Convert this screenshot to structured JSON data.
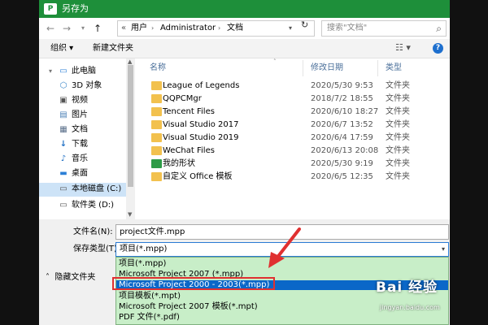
{
  "window": {
    "app_icon_text": "P",
    "title": "另存为",
    "accent_color": "#1e8f3a"
  },
  "nav": {
    "back_icon": "arrow-left-icon",
    "forward_icon": "arrow-right-icon",
    "recent_icon": "chevron-down-icon",
    "up_icon": "arrow-up-icon",
    "breadcrumb": [
      "用户",
      "Administrator",
      "文档"
    ],
    "overflow": "«",
    "search_placeholder": "搜索\"文档\""
  },
  "toolbar": {
    "organize_label": "组织 ▾",
    "new_folder_label": "新建文件夹"
  },
  "sidebar": {
    "items": [
      {
        "label": "此电脑",
        "icon": "computer-icon",
        "glyph": "💻",
        "selected": false,
        "expandable": true
      },
      {
        "label": "3D 对象",
        "icon": "cube-icon",
        "glyph": "⬡",
        "selected": false,
        "expandable": false
      },
      {
        "label": "视频",
        "icon": "video-icon",
        "glyph": "▣",
        "selected": false,
        "expandable": false
      },
      {
        "label": "图片",
        "icon": "picture-icon",
        "glyph": "▤",
        "selected": false,
        "expandable": false
      },
      {
        "label": "文档",
        "icon": "document-icon",
        "glyph": "▦",
        "selected": false,
        "expandable": false
      },
      {
        "label": "下载",
        "icon": "download-icon",
        "glyph": "↓",
        "selected": false,
        "expandable": false
      },
      {
        "label": "音乐",
        "icon": "music-icon",
        "glyph": "♪",
        "selected": false,
        "expandable": false
      },
      {
        "label": "桌面",
        "icon": "desktop-icon",
        "glyph": "▬",
        "selected": false,
        "expandable": false
      },
      {
        "label": "本地磁盘 (C:)",
        "icon": "drive-icon",
        "glyph": "▭",
        "selected": true,
        "expandable": false
      },
      {
        "label": "软件类 (D:)",
        "icon": "drive-icon",
        "glyph": "▭",
        "selected": false,
        "expandable": false
      }
    ]
  },
  "files": {
    "columns": {
      "name": "名称",
      "date": "修改日期",
      "type": "类型"
    },
    "rows": [
      {
        "name": "League of Legends",
        "date": "2020/5/30 9:53",
        "type": "文件夹",
        "icon": "folder-icon"
      },
      {
        "name": "QQPCMgr",
        "date": "2018/7/2 18:55",
        "type": "文件夹",
        "icon": "folder-icon"
      },
      {
        "name": "Tencent Files",
        "date": "2020/6/10 18:27",
        "type": "文件夹",
        "icon": "folder-icon"
      },
      {
        "name": "Visual Studio 2017",
        "date": "2020/6/7 13:52",
        "type": "文件夹",
        "icon": "folder-icon"
      },
      {
        "name": "Visual Studio 2019",
        "date": "2020/6/4 17:59",
        "type": "文件夹",
        "icon": "folder-icon"
      },
      {
        "name": "WeChat Files",
        "date": "2020/6/13 20:08",
        "type": "文件夹",
        "icon": "folder-icon"
      },
      {
        "name": "我的形状",
        "date": "2020/5/30 9:19",
        "type": "文件夹",
        "icon": "shapes-folder-icon"
      },
      {
        "name": "自定义 Office 模板",
        "date": "2020/6/5 12:35",
        "type": "文件夹",
        "icon": "folder-icon"
      }
    ]
  },
  "bottom": {
    "filename_label": "文件名(N):",
    "filename_value": "project文件.mpp",
    "filetype_label": "保存类型(T):",
    "filetype_value": "项目(*.mpp)",
    "hide_folders_label": "隐藏文件夹"
  },
  "dropdown": {
    "options": [
      {
        "label": "项目(*.mpp)",
        "highlighted": false
      },
      {
        "label": "Microsoft Project 2007 (*.mpp)",
        "highlighted": false
      },
      {
        "label": "Microsoft Project 2000 - 2003(*.mpp)",
        "highlighted": true
      },
      {
        "label": "项目模板(*.mpt)",
        "highlighted": false
      },
      {
        "label": "Microsoft Project 2007 模板(*.mpt)",
        "highlighted": false
      },
      {
        "label": "PDF 文件(*.pdf)",
        "highlighted": false
      }
    ],
    "highlight_color": "#0a67c8",
    "background_color": "#c8eec8"
  },
  "annotation": {
    "box_color": "#e03030"
  },
  "watermark": {
    "logo_text": "Bai 经验",
    "url": "jingyan.baidu.com"
  }
}
